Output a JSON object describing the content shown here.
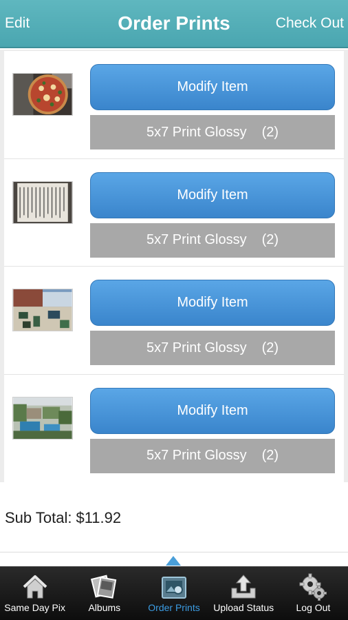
{
  "header": {
    "left_label": "Edit",
    "title": "Order Prints",
    "right_label": "Check Out",
    "bg_color": "#4aa6b0"
  },
  "order_items": [
    {
      "modify_label": "Modify Item",
      "print_label": "5x7 Print Glossy",
      "quantity": "(2)",
      "thumbnail": "pizza-photo"
    },
    {
      "modify_label": "Modify Item",
      "print_label": "5x7 Print Glossy",
      "quantity": "(2)",
      "thumbnail": "document-photo"
    },
    {
      "modify_label": "Modify Item",
      "print_label": "5x7 Print Glossy",
      "quantity": "(2)",
      "thumbnail": "street-photo"
    },
    {
      "modify_label": "Modify Item",
      "print_label": "5x7 Print Glossy",
      "quantity": "(2)",
      "thumbnail": "resort-pool-photo"
    }
  ],
  "subtotal": {
    "label": "Sub Total:",
    "amount": "$11.92"
  },
  "tabbar": {
    "active": "Order Prints",
    "tabs": [
      {
        "label": "Same Day Pix",
        "icon": "house-icon"
      },
      {
        "label": "Albums",
        "icon": "photo-stack-icon"
      },
      {
        "label": "Order Prints",
        "icon": "print-photo-icon"
      },
      {
        "label": "Upload Status",
        "icon": "upload-tray-icon"
      },
      {
        "label": "Log Out",
        "icon": "gears-icon"
      }
    ]
  },
  "colors": {
    "modify_button": "#3a85cc",
    "print_button": "#a8a8a8",
    "active_tab": "#3c9de4"
  }
}
